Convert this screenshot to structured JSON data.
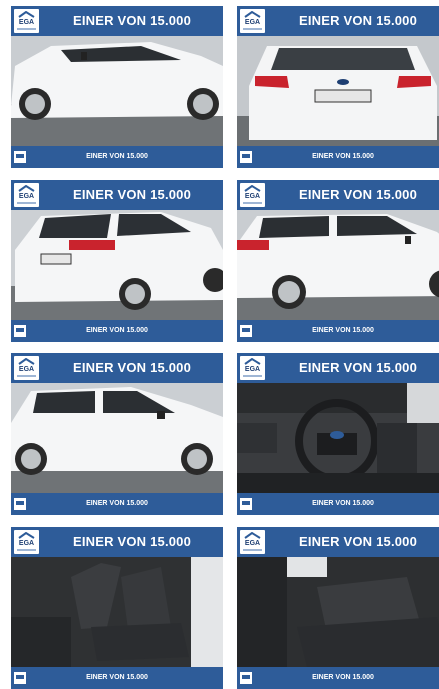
{
  "tiles": [
    {
      "id": 1,
      "banner": "EINER VON 15.000",
      "logo": "EGA",
      "footer": "EINER VON 15.000",
      "view": "side-front-left"
    },
    {
      "id": 2,
      "banner": "EINER VON 15.000",
      "logo": "EGA",
      "footer": "EINER VON 15.000",
      "view": "rear"
    },
    {
      "id": 3,
      "banner": "EINER VON 15.000",
      "logo": "EGA",
      "footer": "EINER VON 15.000",
      "view": "rear-quarter-left"
    },
    {
      "id": 4,
      "banner": "EINER VON 15.000",
      "logo": "EGA",
      "footer": "EINER VON 15.000",
      "view": "side-rear-right"
    },
    {
      "id": 5,
      "banner": "EINER VON 15.000",
      "logo": "EGA",
      "footer": "EINER VON 15.000",
      "view": "side-right"
    },
    {
      "id": 6,
      "banner": "EINER VON 15.000",
      "logo": "EGA",
      "footer": "EINER VON 15.000",
      "view": "dashboard"
    },
    {
      "id": 7,
      "banner": "EINER VON 15.000",
      "logo": "EGA",
      "footer": "EINER VON 15.000",
      "view": "front-seats"
    },
    {
      "id": 8,
      "banner": "EINER VON 15.000",
      "logo": "EGA",
      "footer": "EINER VON 15.000",
      "view": "rear-seats"
    }
  ],
  "colors": {
    "brand_blue": "#2e5c99",
    "car_white": "#f4f5f6",
    "asphalt": "#8a8d90"
  }
}
